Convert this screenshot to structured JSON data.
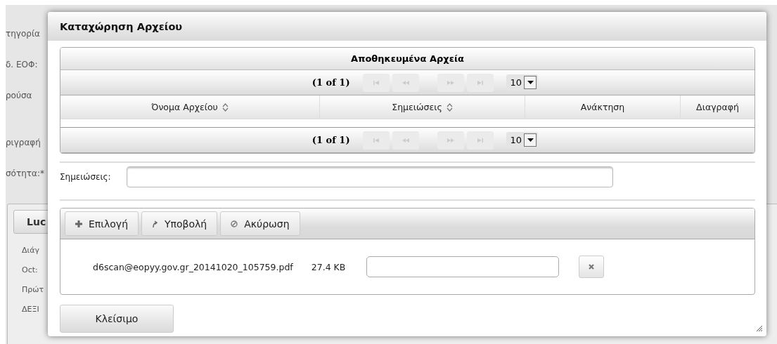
{
  "background": {
    "labels": [
      "τηγορία",
      "δ. ΕΟΦ:",
      "ρούσα",
      "ριγραφή",
      "σότητα:*"
    ],
    "panel": {
      "tab": "Luc",
      "fields": [
        "Διάγ",
        "Oct:",
        "Πρώτ",
        "ΔΕΞΙ"
      ]
    }
  },
  "dialog": {
    "title": "Καταχώρηση Αρχείου",
    "table": {
      "caption": "Αποθηκευμένα Αρχεία",
      "paginator": {
        "page_report": "(1 of 1)",
        "rows_per_page": "10"
      },
      "columns": [
        {
          "label": "Όνομα Αρχείου",
          "sortable": true
        },
        {
          "label": "Σημειώσεις",
          "sortable": true
        },
        {
          "label": "Ανάκτηση",
          "sortable": false
        },
        {
          "label": "Διαγραφή",
          "sortable": false
        }
      ],
      "bottom_paginator": {
        "page_report": "(1 of 1)",
        "rows_per_page": "10"
      }
    },
    "notes": {
      "label": "Σημειώσεις:"
    },
    "upload": {
      "buttons": [
        {
          "label": "Επιλογή",
          "kind": "plus"
        },
        {
          "label": "Υποβολή",
          "kind": "upload"
        },
        {
          "label": "Ακύρωση",
          "kind": "cancel"
        }
      ],
      "files": [
        {
          "name": "d6scan@eopyy.gov.gr_20141020_105759.pdf",
          "size": "27.4 KB"
        }
      ]
    },
    "close_button": "Κλείσιμο"
  }
}
